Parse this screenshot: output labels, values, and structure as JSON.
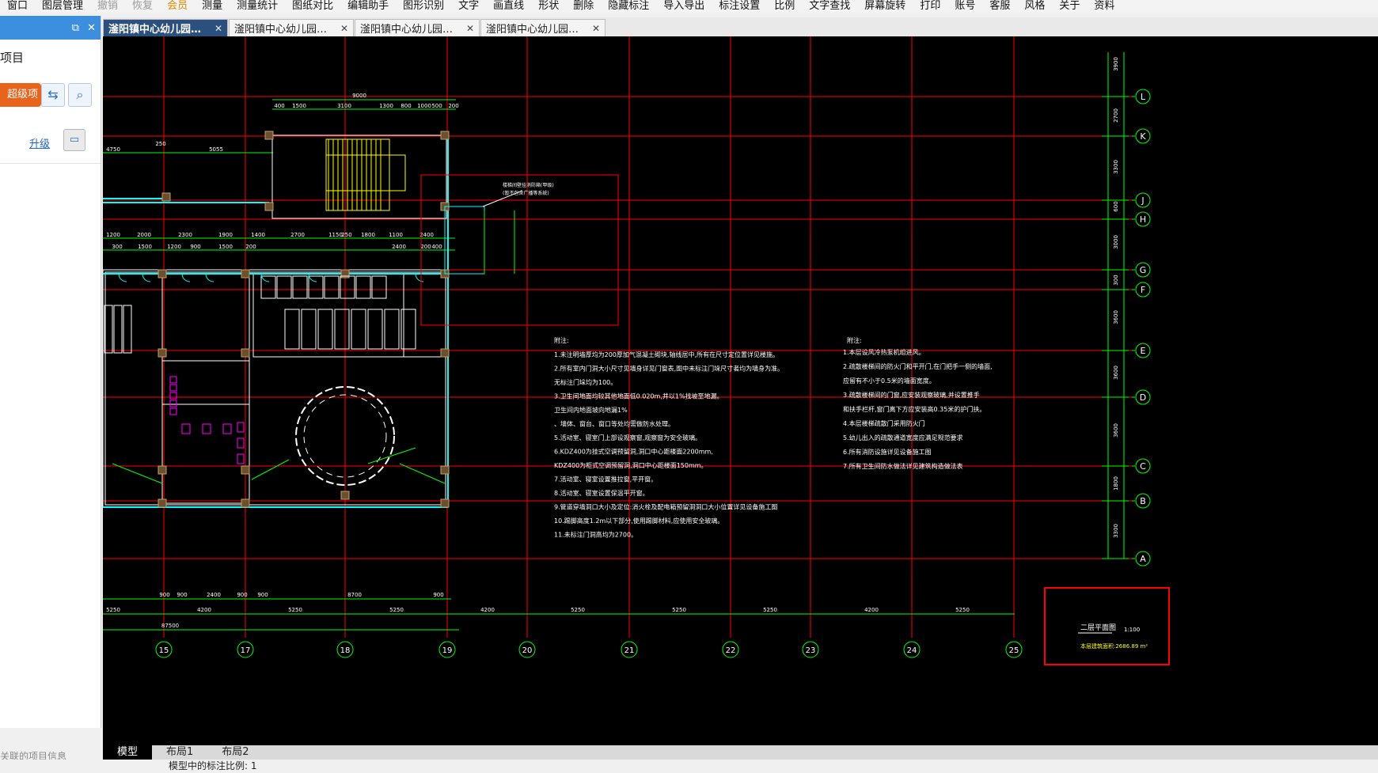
{
  "menu": [
    {
      "label": "窗口",
      "state": "normal"
    },
    {
      "label": "图层管理",
      "state": "normal"
    },
    {
      "label": "撤销",
      "state": "disabled"
    },
    {
      "label": "恢复",
      "state": "disabled"
    },
    {
      "label": "会员",
      "state": "vip"
    },
    {
      "label": "测量",
      "state": "normal"
    },
    {
      "label": "测量统计",
      "state": "normal"
    },
    {
      "label": "图纸对比",
      "state": "normal"
    },
    {
      "label": "编辑助手",
      "state": "normal"
    },
    {
      "label": "图形识别",
      "state": "normal"
    },
    {
      "label": "文字",
      "state": "normal"
    },
    {
      "label": "画直线",
      "state": "normal"
    },
    {
      "label": "形状",
      "state": "normal"
    },
    {
      "label": "删除",
      "state": "normal"
    },
    {
      "label": "隐藏标注",
      "state": "normal"
    },
    {
      "label": "导入导出",
      "state": "normal"
    },
    {
      "label": "标注设置",
      "state": "normal"
    },
    {
      "label": "比例",
      "state": "normal"
    },
    {
      "label": "文字查找",
      "state": "normal"
    },
    {
      "label": "屏幕旋转",
      "state": "normal"
    },
    {
      "label": "打印",
      "state": "normal"
    },
    {
      "label": "账号",
      "state": "normal"
    },
    {
      "label": "客服",
      "state": "normal"
    },
    {
      "label": "风格",
      "state": "normal"
    },
    {
      "label": "关于",
      "state": "normal"
    },
    {
      "label": "资料",
      "state": "normal"
    }
  ],
  "side_panel": {
    "title": "项目",
    "project_button": "超级项目",
    "upgrade_link": "升级",
    "footer": "关联的项目信息"
  },
  "tabs": [
    {
      "label": "滏阳镇中心幼儿园建…",
      "active": true
    },
    {
      "label": "滏阳镇中心幼儿园结…",
      "active": false
    },
    {
      "label": "滏阳镇中心幼儿园建…",
      "active": false
    },
    {
      "label": "滏阳镇中心幼儿园结构",
      "active": false
    }
  ],
  "layout_tabs": [
    {
      "label": "模型",
      "active": true
    },
    {
      "label": "布局1",
      "active": false
    },
    {
      "label": "布局2",
      "active": false
    }
  ],
  "status": "模型中的标注比例: 1",
  "drawing": {
    "bottom_axes": [
      "15",
      "17",
      "18",
      "19",
      "20",
      "21",
      "22",
      "23",
      "24",
      "25"
    ],
    "right_axes": [
      "L",
      "K",
      "J",
      "H",
      "G",
      "F",
      "E",
      "D",
      "C",
      "B",
      "A"
    ],
    "bottom_dims_row1": [
      "900",
      "900",
      "2400",
      "900",
      "900",
      "8700",
      "900"
    ],
    "bottom_dims_row2": [
      "5250",
      "4200",
      "5250",
      "5250",
      "4200",
      "5250",
      "5250",
      "5250",
      "4200",
      "5250",
      "5250"
    ],
    "bottom_total": "87500",
    "top_dims": [
      "9000",
      "400",
      "1500",
      "3100",
      "1300",
      "800",
      "1000",
      "500",
      "200"
    ],
    "left_dims": [
      "4750",
      "250",
      "5055"
    ],
    "mid_dims": [
      "1200",
      "2000",
      "2300",
      "1900",
      "1400",
      "2700",
      "1150",
      "250",
      "1800",
      "1100",
      "2400"
    ],
    "mid_dims2": [
      "300",
      "1500",
      "1200",
      "900",
      "1500",
      "200",
      "2400",
      "200",
      "400"
    ],
    "right_vert_dims": [
      "3900",
      "2700",
      "3300",
      "600",
      "3000",
      "300",
      "3600",
      "3600",
      "3600",
      "1800",
      "3300"
    ],
    "notes_left_title": "附注:",
    "notes_left": [
      "1.未注明墙厚均为200厚加气混凝土砌块,轴线居中,所有在尺寸定位置详见楼施。",
      "2.所有室内门洞大小尺寸见墙身详见门窗表,图中未标注门垛尺寸者均为墙身为准。",
      "无标注门垛均为100。",
      "3.卫生间地面均较其他地面低0.020m,并以1%找坡至地漏。",
      "卫生间内地面坡向地漏1%",
      "、墙体、窗台、窗口等处均需做防水处理。",
      "5.活动室、寝室门上部设观察窗,观察窗为安全玻璃。",
      "6.KDZ400为挂式空调预留洞,洞口中心距楼面2200mm,",
      "KDZ400为柜式空调预留洞,洞口中心距楼面150mm。",
      "7.活动室、寝室设置推拉窗,平开窗。",
      "8.活动室、寝室设置保温平开窗。",
      "9.管道穿墙洞口大小及定位:消火栓及配电箱预留洞洞口大小位置详见设备施工图",
      "10.踢脚高度1.2m以下部分,使用踢脚材料,应使用安全玻璃。",
      "11.未标注门洞高均为2700。"
    ],
    "notes_right_title": "附注:",
    "notes_right": [
      "1.本层设风冷热泵机组进风。",
      "2.疏散楼梯间的防火门和平开门,在门把手一侧的墙面,",
      "应留有不小于0.5米的墙面宽度。",
      "3.疏散楼梯间的门窗,应安装观察玻璃,并设置推手",
      "和扶手栏杆,窗门离下方应安装高0.35米的护门扶。",
      "4.本层楼梯疏散门采用防火门",
      "5.幼儿出入的疏散通道宽度应满足规范要求",
      "6.所有消防设施详见设备施工图",
      "7.所有卫生间防水做法详见建筑构造做法表"
    ],
    "plan_title": "二层平面图",
    "plan_scale": "1:100",
    "plan_area": "本层建筑面积:2686.89 m²",
    "callout": "楼梯间壁挂消防箱(甲级)",
    "callout2": "(暂不包含广播等系统)"
  },
  "colors": {
    "background": "#000000",
    "axis_line": "#ff0000",
    "dim_line": "#00ff00",
    "wall": "#ffffff",
    "stair": "#ffff00",
    "column": "#c8a060",
    "window": "#00ffff",
    "door": "#ff00ff",
    "tab_active": "#2b4f7e",
    "project_button": "#e8641c",
    "side_header": "#3c8edf"
  }
}
